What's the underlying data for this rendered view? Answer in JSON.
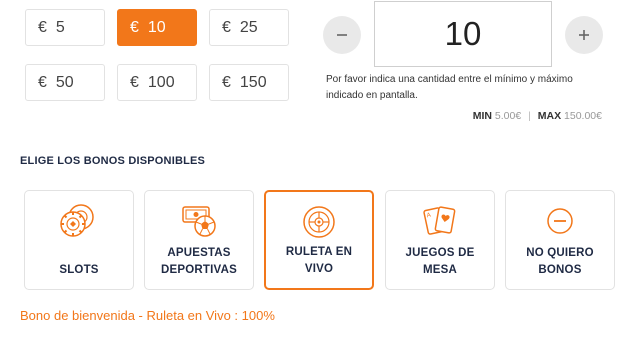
{
  "amounts": [
    {
      "currency": "€",
      "value": "5"
    },
    {
      "currency": "€",
      "value": "10"
    },
    {
      "currency": "€",
      "value": "25"
    },
    {
      "currency": "€",
      "value": "50"
    },
    {
      "currency": "€",
      "value": "100"
    },
    {
      "currency": "€",
      "value": "150"
    }
  ],
  "selected_amount": "10",
  "stepper": {
    "value": "10",
    "minus_icon": "minus-icon",
    "plus_icon": "plus-icon"
  },
  "hint_text": "Por favor indica una cantidad entre el mínimo y máximo indicado en pantalla.",
  "limits": {
    "min_label": "MIN",
    "min_value": "5.00€",
    "separator": "|",
    "max_label": "MAX",
    "max_value": "150.00€"
  },
  "bonus_section": {
    "title": "ELIGE LOS BONOS DISPONIBLES",
    "cards": [
      {
        "label_line1": "SLOTS",
        "label_line2": "",
        "icon": "slots-chips-icon"
      },
      {
        "label_line1": "APUESTAS",
        "label_line2": "DEPORTIVAS",
        "icon": "sports-betting-icon"
      },
      {
        "label_line1": "RULETA EN",
        "label_line2": "VIVO",
        "icon": "roulette-icon"
      },
      {
        "label_line1": "JUEGOS DE",
        "label_line2": "MESA",
        "icon": "playing-cards-icon"
      },
      {
        "label_line1": "NO QUIERO",
        "label_line2": "BONOS",
        "icon": "no-bonus-icon"
      }
    ],
    "selected": "RULETA EN VIVO"
  },
  "welcome_text": "Bono de bienvenida - Ruleta en Vivo : 100%",
  "colors": {
    "accent": "#f2771a",
    "title": "#1f2a44",
    "border": "#e2e2e2"
  }
}
